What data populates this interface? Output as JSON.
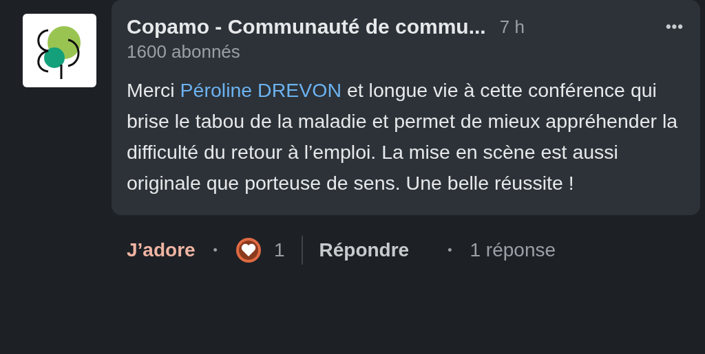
{
  "comment": {
    "author": "Copamo - Communauté de commu...",
    "time": "7 h",
    "menu": "•••",
    "followers": "1600 abonnés",
    "text_before": "Merci ",
    "mention": "Péroline DREVON",
    "text_after": " et longue vie à cette conférence qui brise le tabou de la maladie et permet de mieux appréhender la difficulté du retour à l’emploi. La mise en scène est aussi originale que porteuse de sens. Une belle réussite !"
  },
  "actions": {
    "react_label": "J’adore",
    "reacted": true,
    "separator": "•",
    "reaction_count": "1",
    "reply_label": "Répondre",
    "separator_2": "•",
    "replies": "1 réponse"
  }
}
